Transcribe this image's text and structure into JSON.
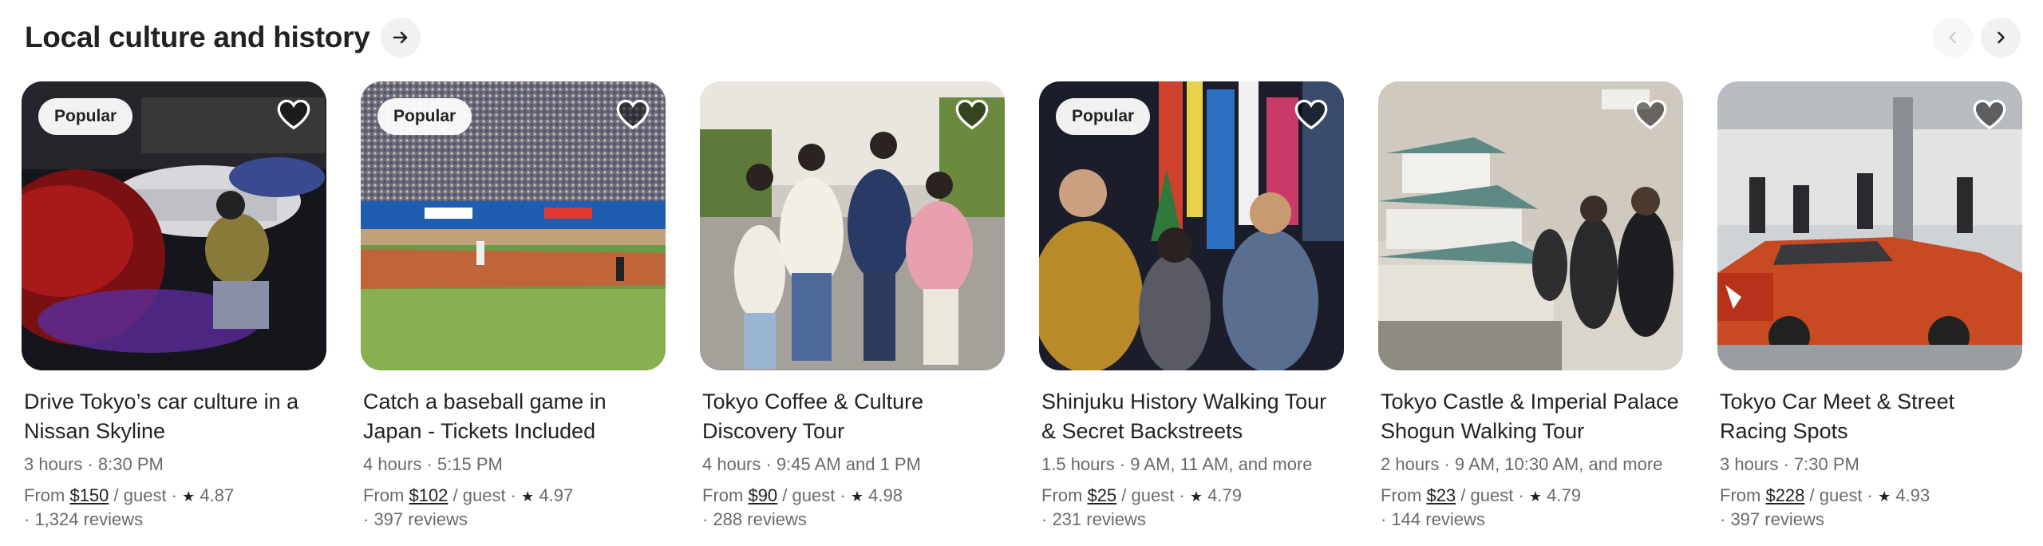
{
  "section": {
    "title": "Local culture and history"
  },
  "cards": [
    {
      "badge": "Popular",
      "title": "Drive Tokyo’s car culture in a Nissan Skyline",
      "details": "3 hours · 8:30 PM",
      "price_prefix": "From",
      "price": "$150",
      "price_suffix": "/ guest ·",
      "rating": "4.87",
      "reviews": "· 1,324 reviews"
    },
    {
      "badge": "Popular",
      "title": "Catch a baseball game in Japan - Tickets Included",
      "details": "4 hours · 5:15 PM",
      "price_prefix": "From",
      "price": "$102",
      "price_suffix": "/ guest ·",
      "rating": "4.97",
      "reviews": "· 397 reviews"
    },
    {
      "badge": "",
      "title": "Tokyo Coffee & Culture Discovery Tour",
      "details": "4 hours · 9:45 AM and 1 PM",
      "price_prefix": "From",
      "price": "$90",
      "price_suffix": "/ guest ·",
      "rating": "4.98",
      "reviews": "· 288 reviews"
    },
    {
      "badge": "Popular",
      "title": "Shinjuku History Walking Tour & Secret Backstreets",
      "details": "1.5 hours · 9 AM, 11 AM, and more",
      "price_prefix": "From",
      "price": "$25",
      "price_suffix": "/ guest ·",
      "rating": "4.79",
      "reviews": "· 231 reviews"
    },
    {
      "badge": "",
      "title": "Tokyo Castle & Imperial Palace Shogun Walking Tour",
      "details": "2 hours · 9 AM, 10:30 AM, and more",
      "price_prefix": "From",
      "price": "$23",
      "price_suffix": "/ guest ·",
      "rating": "4.79",
      "reviews": "· 144 reviews"
    },
    {
      "badge": "",
      "title": "Tokyo Car Meet & Street Racing Spots",
      "details": "3 hours · 7:30 PM",
      "price_prefix": "From",
      "price": "$228",
      "price_suffix": "/ guest ·",
      "rating": "4.93",
      "reviews": "· 397 reviews"
    }
  ],
  "colors": {
    "text": "#222222",
    "muted": "#6a6a6a",
    "circle_bg": "#f1f1f1"
  },
  "icons": {
    "header": "arrow-right-icon",
    "prev": "chevron-left-icon",
    "next": "chevron-right-icon",
    "save": "heart-icon",
    "rating": "star-icon"
  }
}
